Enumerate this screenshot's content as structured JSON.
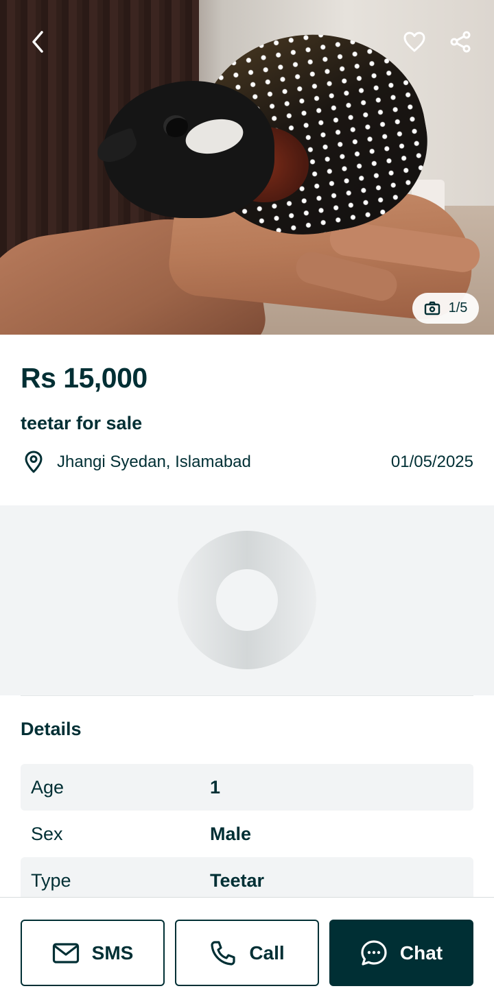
{
  "gallery": {
    "counter": "1/5"
  },
  "listing": {
    "price": "Rs 15,000",
    "title": "teetar for sale",
    "location": "Jhangi Syedan, Islamabad",
    "date": "01/05/2025"
  },
  "details": {
    "heading": "Details",
    "rows": [
      {
        "key": "Age",
        "value": "1"
      },
      {
        "key": "Sex",
        "value": "Male"
      },
      {
        "key": "Type",
        "value": "Teetar"
      }
    ]
  },
  "actions": {
    "sms_label": "SMS",
    "call_label": "Call",
    "chat_label": "Chat"
  },
  "colors": {
    "primary": "#002f34",
    "surface": "#f2f4f5"
  },
  "icons": [
    "back-arrow-icon",
    "heart-icon",
    "share-icon",
    "camera-icon",
    "location-pin-icon",
    "mail-icon",
    "phone-icon",
    "chat-bubble-icon"
  ]
}
